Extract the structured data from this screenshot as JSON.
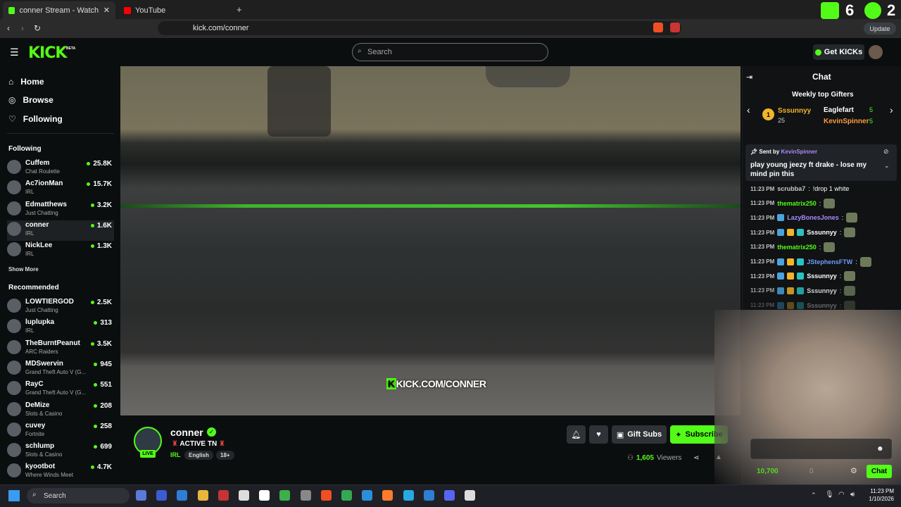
{
  "browser": {
    "tabs": [
      {
        "label": "conner Stream - Watch Live o...",
        "active": true
      },
      {
        "label": "YouTube",
        "active": false
      }
    ],
    "url": "kick.com/conner",
    "update_label": "Update",
    "overlay_counts": [
      "6",
      "2"
    ]
  },
  "header": {
    "logo": "KICK",
    "beta": "BETA",
    "search_placeholder": "Search",
    "get_kicks": "Get KICKs"
  },
  "sidebar": {
    "nav": [
      {
        "label": "Home",
        "icon": "home-icon"
      },
      {
        "label": "Browse",
        "icon": "compass-icon"
      },
      {
        "label": "Following",
        "icon": "heart-icon"
      }
    ],
    "following_title": "Following",
    "following": [
      {
        "name": "Cuffem",
        "category": "Chat Roulette",
        "viewers": "25.8K"
      },
      {
        "name": "Ac7ionMan",
        "category": "IRL",
        "viewers": "15.7K"
      },
      {
        "name": "Edmatthews",
        "category": "Just Chatting",
        "viewers": "3.2K"
      },
      {
        "name": "conner",
        "category": "IRL",
        "viewers": "1.6K"
      },
      {
        "name": "NickLee",
        "category": "IRL",
        "viewers": "1.3K"
      }
    ],
    "show_more": "Show More",
    "recommended_title": "Recommended",
    "recommended": [
      {
        "name": "LOWTIERGOD",
        "category": "Just Chatting",
        "viewers": "2.5K"
      },
      {
        "name": "luplupka",
        "category": "IRL",
        "viewers": "313"
      },
      {
        "name": "TheBurntPeanut",
        "category": "ARC Raiders",
        "viewers": "3.5K"
      },
      {
        "name": "MDSwervin",
        "category": "Grand Theft Auto V (G...",
        "viewers": "945"
      },
      {
        "name": "RayC",
        "category": "Grand Theft Auto V (G...",
        "viewers": "551"
      },
      {
        "name": "DeMize",
        "category": "Slots & Casino",
        "viewers": "208"
      },
      {
        "name": "cuvey",
        "category": "Fortnite",
        "viewers": "258"
      },
      {
        "name": "schlump",
        "category": "Slots & Casino",
        "viewers": "699"
      },
      {
        "name": "kyootbot",
        "category": "Where Winds Meet",
        "viewers": "4.7K"
      }
    ]
  },
  "video": {
    "watermark_k": "K",
    "watermark": "KICK.COM/CONNER"
  },
  "stream": {
    "live": "LIVE",
    "name": "conner",
    "title": "ACTIVE TN",
    "category": "IRL",
    "tags": [
      "English",
      "18+"
    ],
    "gift_subs": "Gift Subs",
    "subscribe": "Subscribe",
    "viewers": "1,605",
    "viewers_label": "Viewers"
  },
  "chat": {
    "title": "Chat",
    "gifters_title": "Weekly top Gifters",
    "gifters": [
      {
        "rank": "1",
        "name": "Sssunnyy",
        "count": "25",
        "color": "#f2b52a"
      },
      {
        "name": "Eaglefart",
        "count": "5",
        "color": "#ffffff"
      },
      {
        "name": "KevinSpinner",
        "count": "5",
        "color": "#ff9c3c"
      }
    ],
    "pinned": {
      "sent_by": "Sent by",
      "user": "KevinSpinner",
      "message": "play young jeezy ft drake - lose my mind pin this"
    },
    "messages": [
      {
        "time": "11:23 PM",
        "user": "scrubba7",
        "text": "!drop 1 white",
        "color": "#c8c8c8"
      },
      {
        "time": "11:23 PM",
        "user": "thematrix250",
        "text": "",
        "color": "#53fc18"
      },
      {
        "time": "11:23 PM",
        "user": "LazyBonesJones",
        "text": "",
        "color": "#a98bff"
      },
      {
        "time": "11:23 PM",
        "user": "Sssunnyy",
        "text": "",
        "color": "#ffffff"
      },
      {
        "time": "11:23 PM",
        "user": "thematrix250",
        "text": "",
        "color": "#53fc18"
      },
      {
        "time": "11:23 PM",
        "user": "JStephensFTW",
        "text": "",
        "color": "#6f9bff"
      },
      {
        "time": "11:23 PM",
        "user": "Sssunnyy",
        "text": "",
        "color": "#ffffff"
      },
      {
        "time": "11:23 PM",
        "user": "Sssunnyy",
        "text": "",
        "color": "#ffffff"
      },
      {
        "time": "11:23 PM",
        "user": "Sssunnyy",
        "text": "",
        "color": "#ffffff"
      }
    ],
    "points": "10,700",
    "points2": "0",
    "send": "Chat"
  },
  "taskbar": {
    "search": "Search",
    "time": "11:23 PM",
    "date": "1/10/2026"
  }
}
